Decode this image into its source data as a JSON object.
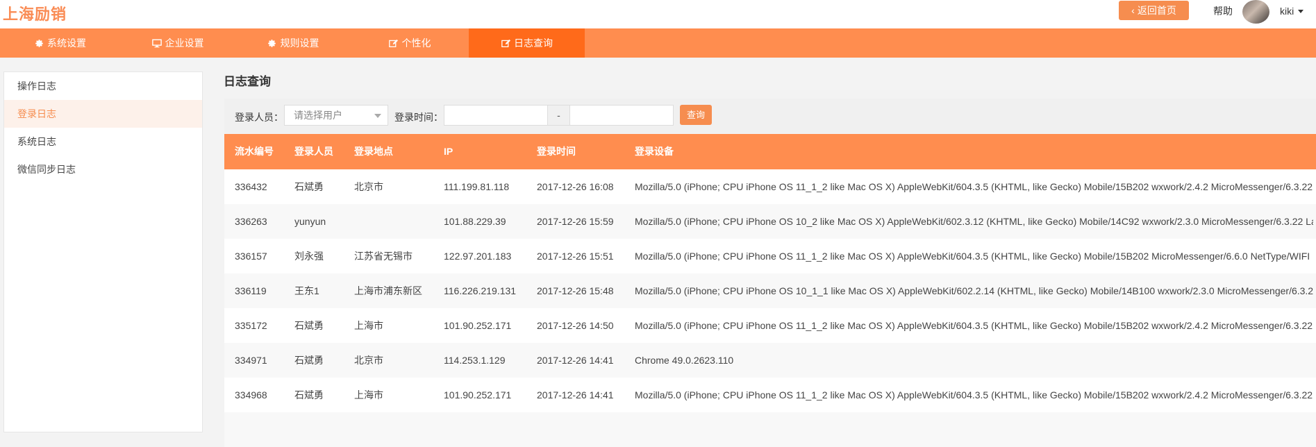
{
  "header": {
    "brand": "上海励销",
    "back_label": "返回首页",
    "help_label": "帮助",
    "username": "kiki",
    "accent_color": "#ff8d4f"
  },
  "nav": {
    "items": [
      {
        "label": "系统设置",
        "icon": "gear-icon"
      },
      {
        "label": "企业设置",
        "icon": "monitor-icon"
      },
      {
        "label": "规则设置",
        "icon": "gear-icon"
      },
      {
        "label": "个性化",
        "icon": "edit-icon"
      },
      {
        "label": "日志查询",
        "icon": "edit-icon",
        "active": true
      }
    ]
  },
  "sidebar": {
    "items": [
      {
        "label": "操作日志"
      },
      {
        "label": "登录日志",
        "active": true
      },
      {
        "label": "系统日志"
      },
      {
        "label": "微信同步日志"
      }
    ]
  },
  "main": {
    "title": "日志查询",
    "filter": {
      "user_label": "登录人员：",
      "user_placeholder": "请选择用户",
      "time_label": "登录时间：",
      "dash": "-",
      "search_label": "查询"
    },
    "table": {
      "headers": [
        "流水编号",
        "登录人员",
        "登录地点",
        "IP",
        "登录时间",
        "登录设备"
      ],
      "rows": [
        [
          "336432",
          "石斌勇",
          "北京市",
          "111.199.81.118",
          "2017-12-26 16:08",
          "Mozilla/5.0 (iPhone; CPU iPhone OS 11_1_2 like Mac OS X) AppleWebKit/604.3.5 (KHTML, like Gecko) Mobile/15B202 wxwork/2.4.2 MicroMessenger/6.3.22"
        ],
        [
          "336263",
          "yunyun",
          "",
          "101.88.229.39",
          "2017-12-26 15:59",
          "Mozilla/5.0 (iPhone; CPU iPhone OS 10_2 like Mac OS X) AppleWebKit/602.3.12 (KHTML, like Gecko) Mobile/14C92 wxwork/2.3.0 MicroMessenger/6.3.22 La"
        ],
        [
          "336157",
          "刘永强",
          "江苏省无锡市",
          "122.97.201.183",
          "2017-12-26 15:51",
          "Mozilla/5.0 (iPhone; CPU iPhone OS 11_1_2 like Mac OS X) AppleWebKit/604.3.5 (KHTML, like Gecko) Mobile/15B202 MicroMessenger/6.6.0 NetType/WIFI"
        ],
        [
          "336119",
          "王东1",
          "上海市浦东新区",
          "116.226.219.131",
          "2017-12-26 15:48",
          "Mozilla/5.0 (iPhone; CPU iPhone OS 10_1_1 like Mac OS X) AppleWebKit/602.2.14 (KHTML, like Gecko) Mobile/14B100 wxwork/2.3.0 MicroMessenger/6.3.2"
        ],
        [
          "335172",
          "石斌勇",
          "上海市",
          "101.90.252.171",
          "2017-12-26 14:50",
          "Mozilla/5.0 (iPhone; CPU iPhone OS 11_1_2 like Mac OS X) AppleWebKit/604.3.5 (KHTML, like Gecko) Mobile/15B202 wxwork/2.4.2 MicroMessenger/6.3.22"
        ],
        [
          "334971",
          "石斌勇",
          "北京市",
          "114.253.1.129",
          "2017-12-26 14:41",
          "Chrome 49.0.2623.110"
        ],
        [
          "334968",
          "石斌勇",
          "上海市",
          "101.90.252.171",
          "2017-12-26 14:41",
          "Mozilla/5.0 (iPhone; CPU iPhone OS 11_1_2 like Mac OS X) AppleWebKit/604.3.5 (KHTML, like Gecko) Mobile/15B202 wxwork/2.4.2 MicroMessenger/6.3.22"
        ]
      ]
    }
  }
}
